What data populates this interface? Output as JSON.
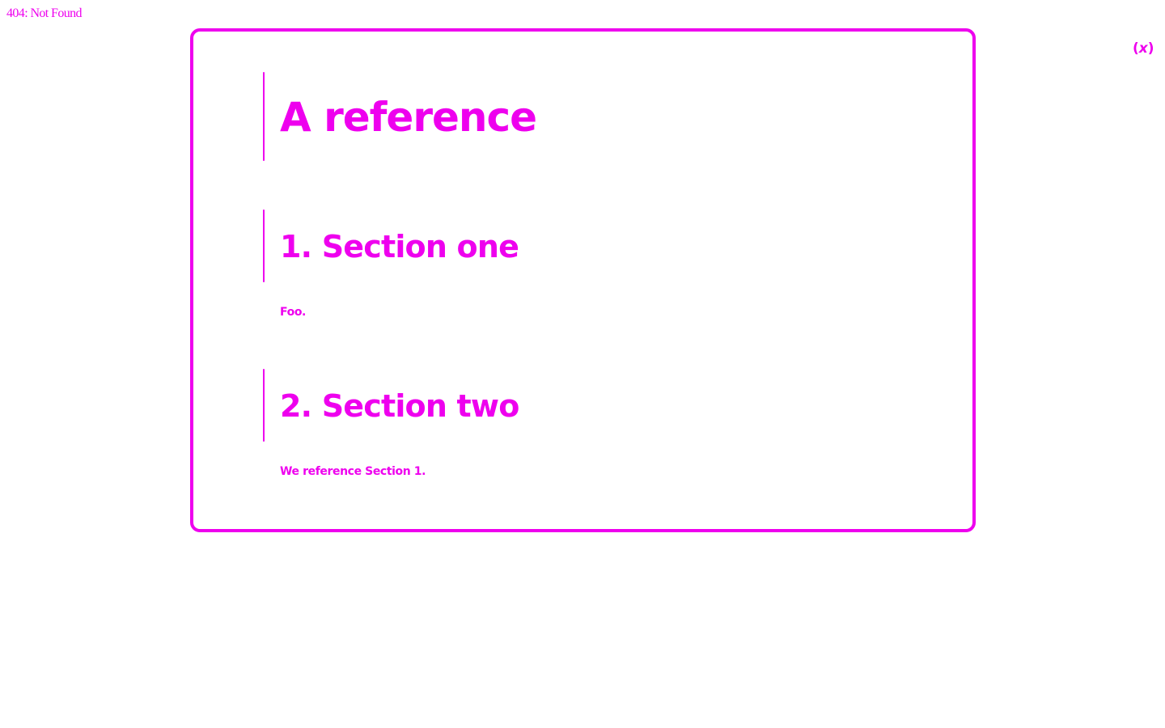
{
  "status": {
    "error_text": "404: Not Found"
  },
  "close": {
    "paren_open": "(",
    "variable": "x",
    "paren_close": ")"
  },
  "document": {
    "title": "A reference",
    "sections": [
      {
        "heading": "1. Section one",
        "body": "Foo."
      },
      {
        "heading": "2. Section two",
        "body_prefix": "We reference ",
        "link_text": "Section 1",
        "body_suffix": "."
      }
    ]
  },
  "colors": {
    "accent": "#ee00ee",
    "background": "#ffffff"
  }
}
